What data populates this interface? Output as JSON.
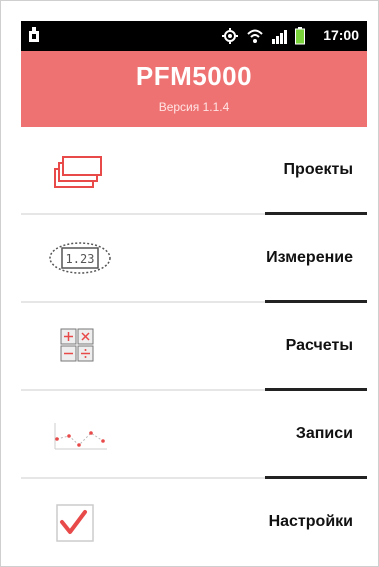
{
  "status_bar": {
    "time": "17:00"
  },
  "header": {
    "title": "PFM5000",
    "version": "Версия 1.1.4"
  },
  "menu": {
    "items": [
      {
        "label": "Проекты",
        "icon": "projects-icon"
      },
      {
        "label": "Измерение",
        "icon": "measurement-icon",
        "icon_text": "1.23"
      },
      {
        "label": "Расчеты",
        "icon": "calculator-icon"
      },
      {
        "label": "Записи",
        "icon": "records-chart-icon"
      },
      {
        "label": "Настройки",
        "icon": "settings-checkbox-icon"
      }
    ]
  },
  "colors": {
    "header_bg": "#ee7272",
    "status_bar_bg": "#000000",
    "accent": "#e84a4a"
  }
}
